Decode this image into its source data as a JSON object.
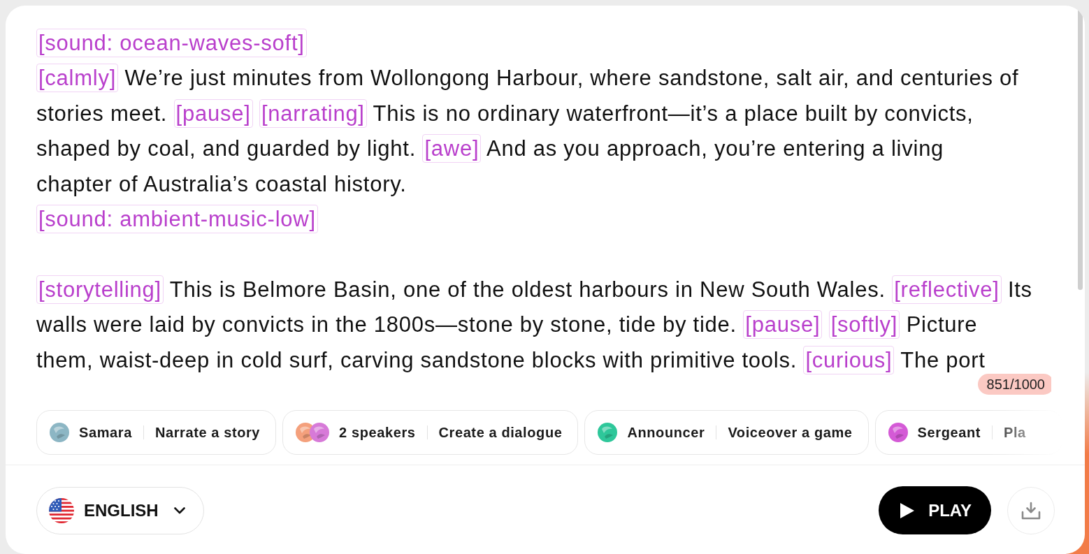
{
  "editor": {
    "paragraphs": [
      {
        "lines": [
          {
            "segments": [
              {
                "kind": "tag",
                "text": "[sound: ocean-waves-soft]"
              }
            ]
          },
          {
            "segments": [
              {
                "kind": "tag",
                "text": "[calmly]"
              },
              {
                "kind": "text",
                "text": "We’re just minutes from Wollongong Harbour, where sandstone, salt air, and centuries of"
              }
            ]
          },
          {
            "segments": [
              {
                "kind": "text",
                "text": "stories meet."
              },
              {
                "kind": "tag",
                "text": "[pause]"
              },
              {
                "kind": "tag",
                "text": "[narrating]"
              },
              {
                "kind": "text",
                "text": "This is no ordinary waterfront—it’s a place built by convicts,"
              }
            ]
          },
          {
            "segments": [
              {
                "kind": "text",
                "text": "shaped by coal, and guarded by light."
              },
              {
                "kind": "tag",
                "text": "[awe]"
              },
              {
                "kind": "text",
                "text": "And as you approach, you’re entering a living"
              }
            ]
          },
          {
            "segments": [
              {
                "kind": "text",
                "text": "chapter of Australia’s coastal history."
              }
            ]
          },
          {
            "segments": [
              {
                "kind": "tag",
                "text": "[sound: ambient-music-low]"
              }
            ]
          }
        ]
      },
      {
        "lines": [
          {
            "segments": [
              {
                "kind": "tag",
                "text": "[storytelling]"
              },
              {
                "kind": "text",
                "text": "This is Belmore Basin, one of the oldest harbours in New South Wales."
              },
              {
                "kind": "tag",
                "text": "[reflective]"
              },
              {
                "kind": "text",
                "text": "Its"
              }
            ]
          },
          {
            "segments": [
              {
                "kind": "text",
                "text": "walls were laid by convicts in the 1800s—stone by stone, tide by tide."
              },
              {
                "kind": "tag",
                "text": "[pause]"
              },
              {
                "kind": "tag",
                "text": "[softly]"
              },
              {
                "kind": "text",
                "text": "Picture"
              }
            ]
          },
          {
            "segments": [
              {
                "kind": "text",
                "text": "them, waist-deep in cold surf, carving sandstone blocks with primitive tools."
              },
              {
                "kind": "tag",
                "text": "[curious]"
              },
              {
                "kind": "text",
                "text": "The port"
              }
            ]
          }
        ]
      }
    ],
    "character_count": "851/1000"
  },
  "presets": [
    {
      "avatars": [
        {
          "color": "#8cb6c4"
        }
      ],
      "voice": "Samara",
      "label": "Narrate a story"
    },
    {
      "avatars": [
        {
          "color": "#f4a07c"
        },
        {
          "color": "#d77ad8"
        }
      ],
      "voice": "2 speakers",
      "label": "Create a dialogue"
    },
    {
      "avatars": [
        {
          "color": "#2ec79a"
        }
      ],
      "voice": "Announcer",
      "label": "Voiceover a game"
    },
    {
      "avatars": [
        {
          "color": "#d45ad6"
        }
      ],
      "voice": "Sergeant",
      "label": "Pla"
    }
  ],
  "language": {
    "label": "ENGLISH"
  },
  "play_button": {
    "label": "PLAY"
  }
}
